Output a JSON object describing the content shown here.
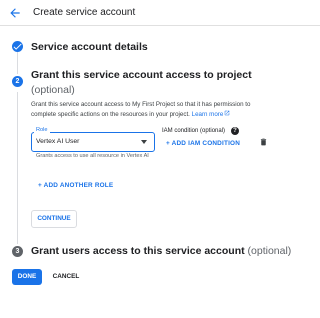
{
  "header": {
    "back_icon": "arrow-back-icon",
    "title": "Create service account"
  },
  "steps": [
    {
      "number": "1",
      "status": "complete",
      "icon": "check-icon",
      "title": "Service account details"
    },
    {
      "number": "2",
      "status": "active",
      "title": "Grant this service account access to project",
      "optional": "(optional)",
      "description": "Grant this service account access to My First Project so that it has permission to complete specific actions on the resources in your project.",
      "learn_more": "Learn more"
    },
    {
      "number": "3",
      "status": "pending",
      "title": "Grant users access to this service account",
      "optional": "(optional)"
    }
  ],
  "role": {
    "label": "Role",
    "value": "Vertex AI User",
    "help": "Grants access to use all resource in Vertex AI"
  },
  "iam_condition": {
    "title": "IAM condition (optional)",
    "help_icon": "help-icon",
    "add_label": "+ ADD IAM CONDITION"
  },
  "delete_icon": "trash-icon",
  "add_another_role": "+ ADD ANOTHER ROLE",
  "continue_label": "CONTINUE",
  "footer": {
    "done_label": "DONE",
    "cancel_label": "CANCEL"
  },
  "colors": {
    "accent": "#1a73e8",
    "text": "#202124",
    "muted": "#5f6368"
  }
}
